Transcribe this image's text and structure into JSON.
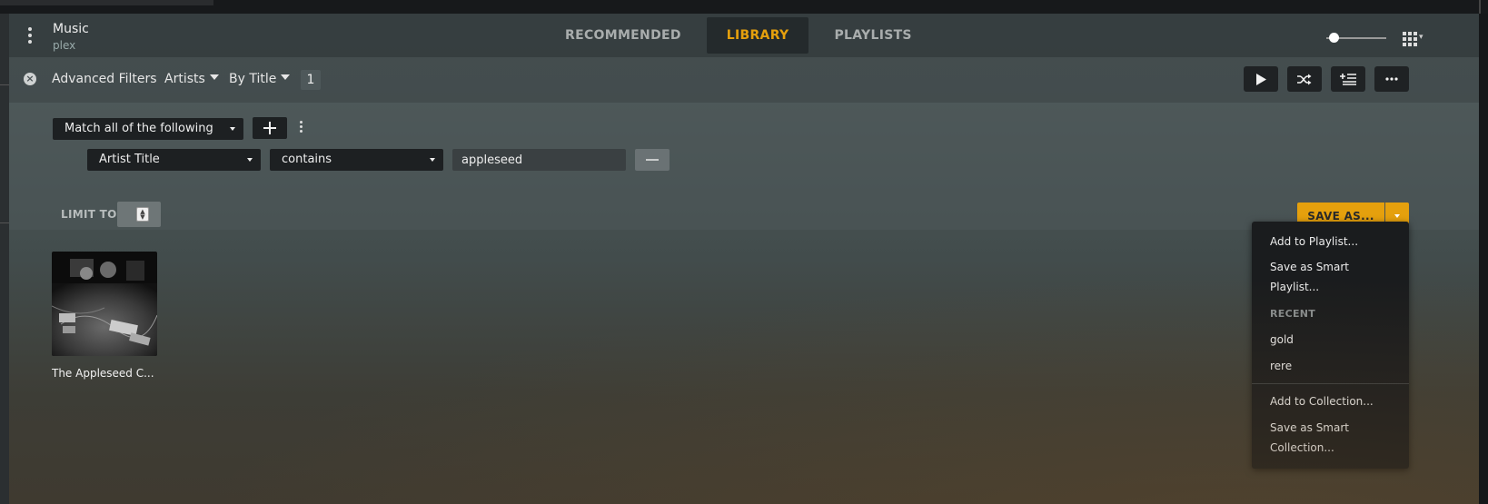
{
  "header": {
    "title": "Music",
    "subtitle": "plex",
    "tabs": [
      {
        "label": "RECOMMENDED"
      },
      {
        "label": "LIBRARY"
      },
      {
        "label": "PLAYLISTS"
      }
    ],
    "active_tab": "LIBRARY"
  },
  "filterbar": {
    "advanced_filters_label": "Advanced Filters",
    "type_label": "Artists",
    "sort_label": "By Title",
    "count": "1"
  },
  "filter_panel": {
    "match_select": "Match all of the following",
    "rule": {
      "field": "Artist Title",
      "operator": "contains",
      "value": "appleseed"
    },
    "limit_label": "LIMIT TO"
  },
  "save": {
    "label": "SAVE AS..."
  },
  "save_menu": {
    "add_to_playlist": "Add to Playlist...",
    "save_smart_playlist_l1": "Save as Smart",
    "save_smart_playlist_l2": "Playlist...",
    "recent_heading": "RECENT",
    "recent_items": [
      "gold",
      "rere"
    ],
    "add_to_collection": "Add to Collection...",
    "save_smart_collection_l1": "Save as Smart",
    "save_smart_collection_l2": "Collection..."
  },
  "albums": [
    {
      "title": "The Appleseed C..."
    }
  ],
  "colors": {
    "accent": "#e5a00d",
    "menu_bg": "#1a1c1e"
  },
  "icons": [
    "menu-icon",
    "clear-filter-icon",
    "play-icon",
    "shuffle-icon",
    "add-to-queue-icon",
    "more-icon",
    "grid-view-icon",
    "plus-icon",
    "minus-icon"
  ]
}
